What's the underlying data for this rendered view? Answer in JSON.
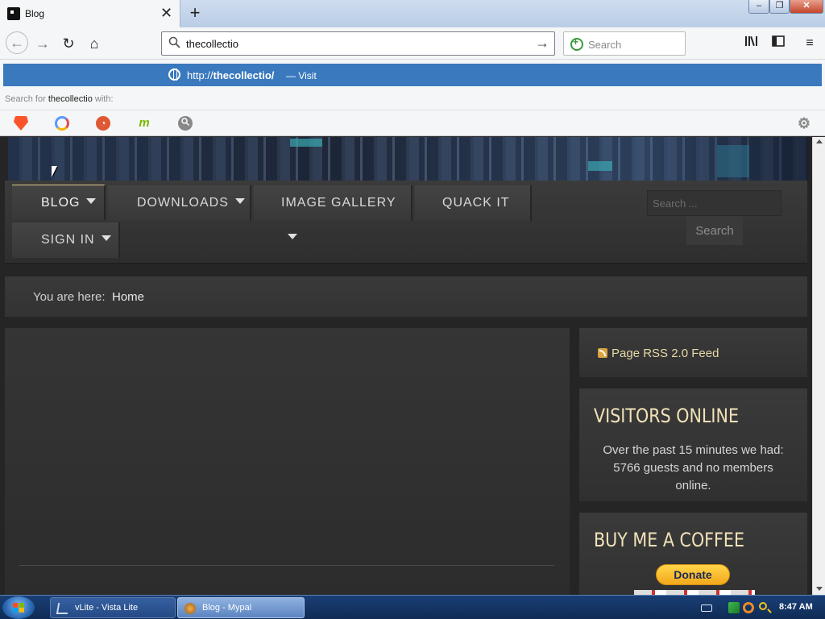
{
  "browser": {
    "tab": {
      "title": "Blog",
      "close_glyph": "✕",
      "favicon": "site-favicon"
    },
    "new_tab_glyph": "+",
    "window_controls": {
      "minimize": "–",
      "maximize": "❐",
      "close": "✕"
    },
    "nav": {
      "back": "←",
      "forward": "→",
      "reload": "↻",
      "home": "⌂"
    },
    "urlbar": {
      "value": "thecollectio",
      "go_glyph": "→",
      "icon": "search-icon"
    },
    "searchbar": {
      "placeholder": "Search"
    },
    "toolbar_icons": {
      "library": "𝍪",
      "sidebar": "◫",
      "menu": "≡"
    },
    "dropdown": {
      "suggestion_url_prefix": "http://",
      "suggestion_url_bold": "thecollectio/",
      "suggestion_action": "— Visit",
      "search_for_prefix": "Search for",
      "search_for_query": "thecollectio",
      "search_for_suffix": "with:",
      "engines": [
        "brave",
        "qwant",
        "duckduckgo",
        "mojeek",
        "generic-search"
      ],
      "engine_glyphs": {
        "brave": "",
        "qwant": "",
        "duckduckgo": "◔",
        "mojeek": "m",
        "generic": "🔍"
      },
      "settings_glyph": "⚙"
    }
  },
  "site": {
    "menu": {
      "blog": "BLOG",
      "downloads": "DOWNLOADS",
      "image_gallery": "IMAGE GALLERY",
      "quack_it": "QUACK IT",
      "sign_in": "SIGN IN"
    },
    "search": {
      "placeholder": "Search ...",
      "button": "Search"
    },
    "breadcrumb": {
      "label": "You are here:",
      "home": "Home"
    },
    "rss": {
      "label": "Page RSS 2.0 Feed"
    },
    "visitors": {
      "title": "VISITORS ONLINE",
      "text": "Over the past 15 minutes we had: 5766 guests and no members online."
    },
    "coffee": {
      "title": "BUY ME A COFFEE",
      "donate": "Donate"
    }
  },
  "taskbar": {
    "tasks": [
      {
        "label": "vLite - Vista Lite"
      },
      {
        "label": "Blog - Mypal"
      }
    ],
    "clock": "8:47 AM"
  },
  "colors": {
    "accent_blue": "#3a79bd",
    "heading_gold": "#f2e2b8",
    "donate_yellow": "#ffd54a"
  }
}
